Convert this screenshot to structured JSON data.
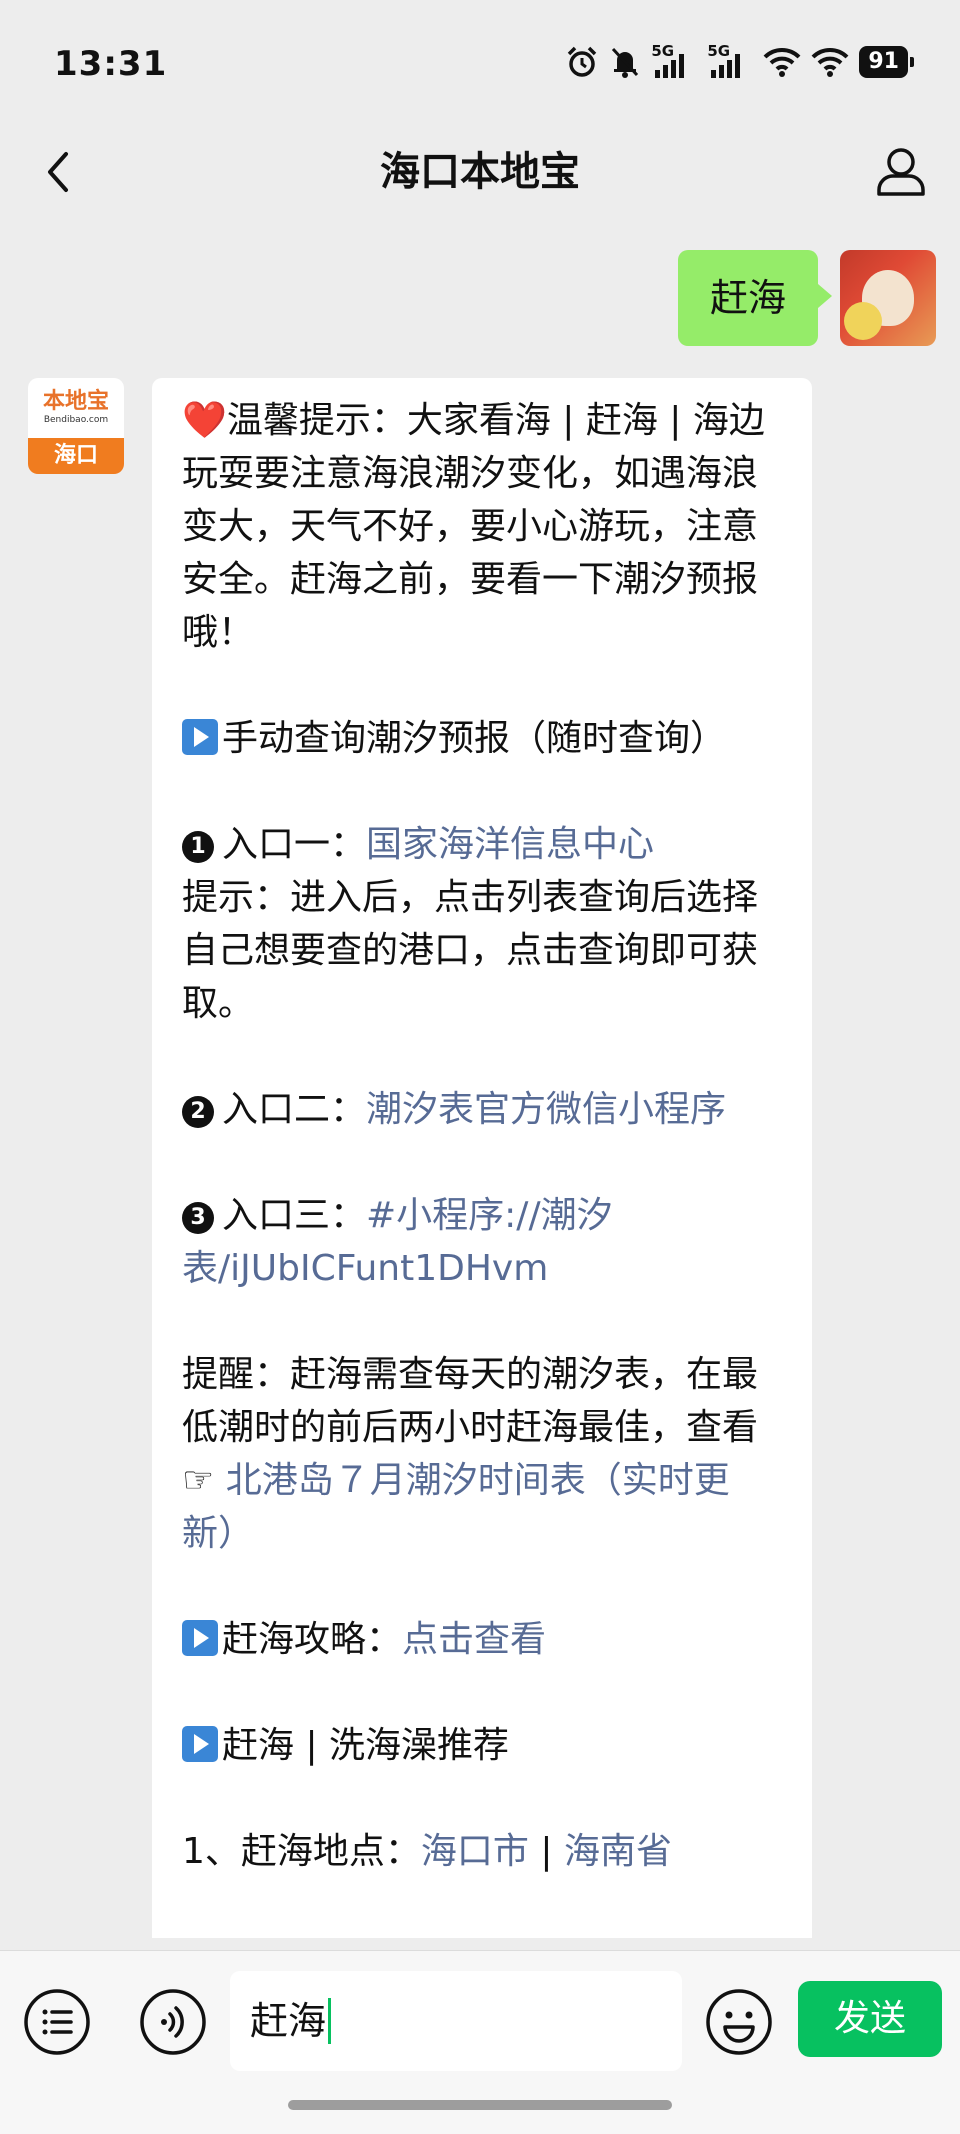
{
  "status": {
    "time": "13:31",
    "net1": "5G",
    "net2": "5G",
    "battery": "91"
  },
  "nav": {
    "title": "海口本地宝"
  },
  "chat": {
    "me": {
      "message": "赶海"
    },
    "bot": {
      "avatar_logo": "本地宝",
      "avatar_url": "Bendibao.com",
      "avatar_city": "海口",
      "tip_heart": "❤️",
      "tip_text": "温馨提示：大家看海 | 赶海 | 海边玩耍要注意海浪潮汐变化，如遇海浪变大，天气不好，要小心游玩，注意安全。赶海之前，要看一下潮汐预报哦！",
      "manual_query": "手动查询潮汐预报（随时查询）",
      "entry1_num": "1",
      "entry1_label": "入口一：",
      "entry1_link": "国家海洋信息中心",
      "entry1_hint": "提示：进入后，点击列表查询后选择自己想要查的港口，点击查询即可获取。",
      "entry2_num": "2",
      "entry2_label": "入口二：",
      "entry2_link": "潮汐表官方微信小程序",
      "entry3_num": "3",
      "entry3_label": "入口三：",
      "entry3_link": "#小程序://潮汐表/iJUbICFunt1DHvm",
      "reminder_text": "提醒：赶海需查每天的潮汐表，在最低潮时的前后两小时赶海最佳，查看 ☞ ",
      "reminder_link": "北港岛７月潮汐时间表（实时更新）",
      "guide_label": "赶海攻略：",
      "guide_link": "点击查看",
      "recommend": "赶海 | 洗海澡推荐",
      "loc_label": "1、赶海地点：",
      "loc_link1": "海口市",
      "loc_sep": " | ",
      "loc_link2": "海南省"
    }
  },
  "input": {
    "value": "赶海",
    "send_label": "发送"
  }
}
